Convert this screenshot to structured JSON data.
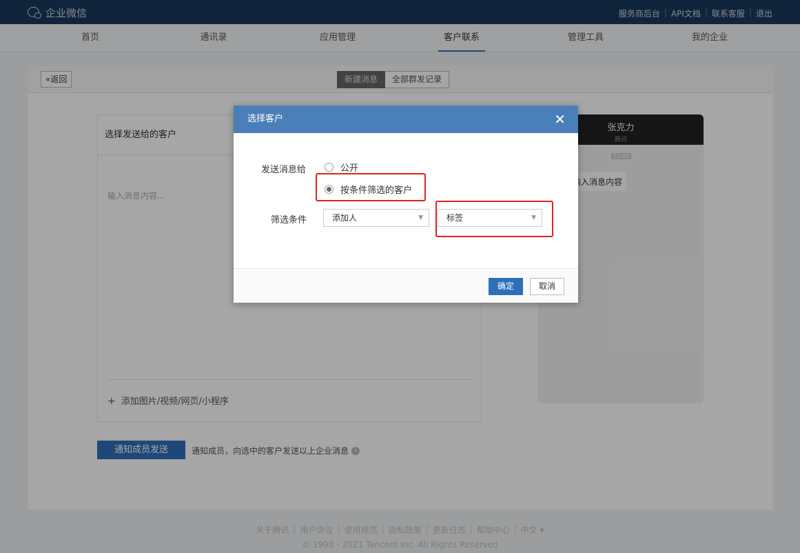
{
  "topbar": {
    "logo": "企业微信",
    "links": [
      "服务商后台",
      "API文档",
      "联系客服",
      "退出"
    ]
  },
  "nav": {
    "items": [
      "首页",
      "通讯录",
      "应用管理",
      "客户联系",
      "管理工具",
      "我的企业"
    ],
    "active": "客户联系"
  },
  "panel": {
    "back_label": "返回",
    "tabs": [
      "新建消息",
      "全部群发记录"
    ],
    "compose": {
      "header": "选择发送给的客户",
      "placeholder": "输入消息内容...",
      "add_media": "添加图片/视频/网页/小程序"
    },
    "preview": {
      "name": "张克力",
      "company": "腾讯",
      "time": "12:00",
      "bubble": "输入消息内容"
    },
    "send_button": "通知成员发送",
    "send_hint": "通知成员，向选中的客户发送以上企业消息"
  },
  "modal": {
    "title": "选择客户",
    "send_to_label": "发送消息给",
    "options": [
      "公开",
      "按条件筛选的客户"
    ],
    "selected_option": "按条件筛选的客户",
    "filter_label": "筛选条件",
    "filter_adder": "添加人",
    "filter_tag": "标签",
    "ok": "确定",
    "cancel": "取消",
    "highlight_color": "#e02020",
    "header_color": "#4a7fb8"
  },
  "footer": {
    "links": [
      "关于腾讯",
      "用户协议",
      "使用规范",
      "隐私政策",
      "更新日志",
      "帮助中心",
      "中文 ▾"
    ],
    "copyright": "© 1998 - 2021 Tencent Inc. All Rights Reserved"
  }
}
